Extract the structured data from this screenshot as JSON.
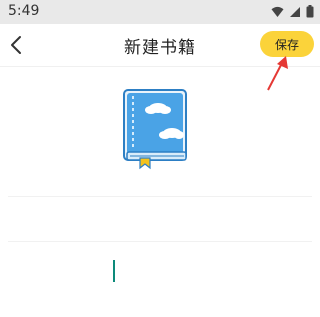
{
  "status_bar": {
    "time": "5:49",
    "icons": [
      "wifi-icon",
      "signal-icon",
      "battery-icon"
    ]
  },
  "header": {
    "title": "新建书籍",
    "back_icon": "chevron-left-icon",
    "save_label": "保存"
  },
  "colors": {
    "accent": "#fbd33a",
    "arrow": "#e53935",
    "book_cover": "#4aa3e6",
    "caret": "#0d8a7a"
  },
  "form": {
    "name_value": "",
    "description_value": ""
  }
}
